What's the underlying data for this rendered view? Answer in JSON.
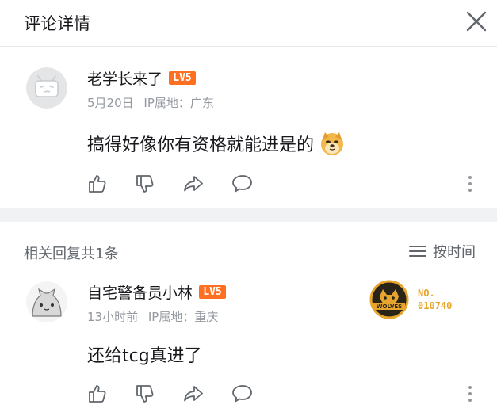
{
  "header": {
    "title": "评论详情",
    "close_icon": "close-icon"
  },
  "main_comment": {
    "username": "老学长来了",
    "level_badge": "LV5",
    "date": "5月20日",
    "ip": "IP属地：广东",
    "content": "搞得好像你有资格就能进是的",
    "emoji": "doge-emoji",
    "actions": [
      "like-icon",
      "dislike-icon",
      "share-icon",
      "comment-icon",
      "more-icon"
    ]
  },
  "related": {
    "title": "相关回复共1条",
    "sort_label": "按时间"
  },
  "reply": {
    "username": "自宅警备员小林",
    "level_badge": "LV5",
    "time": "13小时前",
    "ip": "IP属地：重庆",
    "content": "还给tcg真进了",
    "fan_medal": {
      "name": "WOLVES",
      "no_label": "NO.",
      "number": "010740"
    },
    "actions": [
      "like-icon",
      "dislike-icon",
      "share-icon",
      "comment-icon",
      "more-icon"
    ]
  },
  "colors": {
    "level_badge": "#ff6f22",
    "meta_text": "#9499a0",
    "medal_gold": "#e7a52b",
    "section_gap": "#f1f2f3"
  }
}
